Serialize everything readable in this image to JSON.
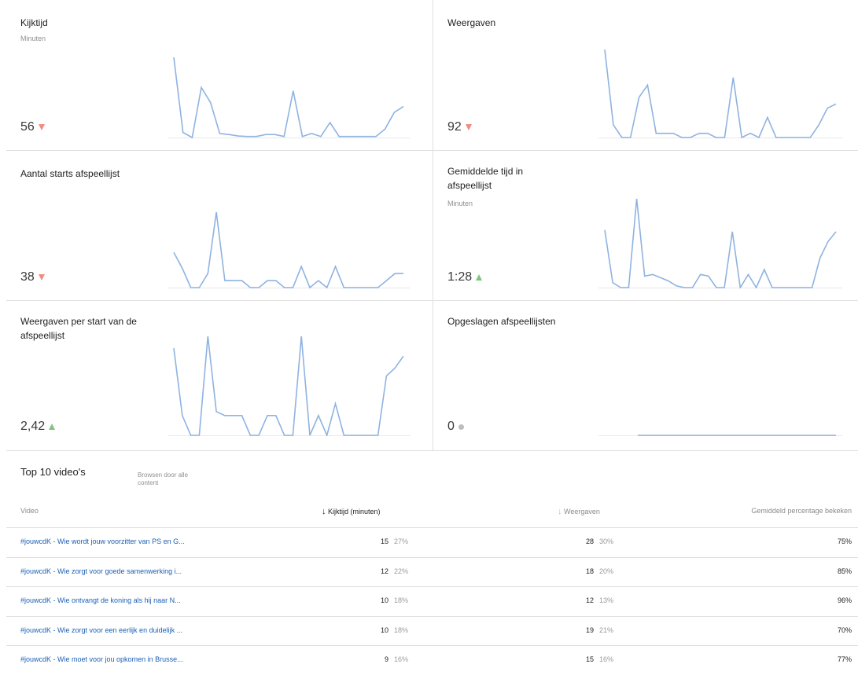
{
  "cards": [
    {
      "title": "Kijktijd",
      "unit": "Minuten",
      "value": "56",
      "trend": "down",
      "spark": [
        16,
        1,
        0,
        10,
        7,
        0.8,
        0.6,
        0.3,
        0.2,
        0.2,
        0.6,
        0.6,
        0.2,
        9.3,
        0.2,
        0.8,
        0.2,
        3,
        0.2,
        0.2,
        0.2,
        0.2,
        0.2,
        1.7,
        5,
        6.2
      ]
    },
    {
      "title": "Weergaven",
      "unit": "",
      "value": "92",
      "trend": "down",
      "spark": [
        21,
        3,
        0,
        0,
        9.6,
        12.5,
        1,
        1,
        1,
        0,
        0,
        1,
        1,
        0,
        0,
        14.3,
        0,
        1,
        0,
        4.8,
        0,
        0,
        0,
        0,
        0,
        3,
        7,
        8
      ]
    },
    {
      "title": "Aantal starts afspeellijst",
      "unit": "",
      "value": "38",
      "trend": "down",
      "spark": [
        4,
        2.2,
        0,
        0,
        1.6,
        8.6,
        0.8,
        0.8,
        0.8,
        0,
        0,
        0.8,
        0.8,
        0,
        0,
        2.4,
        0,
        0.8,
        0,
        2.4,
        0,
        0,
        0,
        0,
        0,
        0.8,
        1.6,
        1.6
      ]
    },
    {
      "title": "Gemiddelde tijd in afspeellijst",
      "unit": "Minuten",
      "value": "1:28",
      "trend": "up",
      "spark": [
        3.5,
        0.3,
        0,
        0,
        5.4,
        0.7,
        0.8,
        0.6,
        0.4,
        0.1,
        0,
        0,
        0.8,
        0.7,
        0,
        0,
        3.4,
        0,
        0.8,
        0,
        1.1,
        0,
        0,
        0,
        0,
        0,
        0,
        1.8,
        2.8,
        3.4
      ]
    },
    {
      "title": "Weergaven per start van de afspeellijst",
      "unit": "",
      "value": "2,42",
      "trend": "up",
      "spark": [
        4.4,
        1,
        0,
        0,
        5,
        1.2,
        1,
        1,
        1,
        0,
        0,
        1,
        1,
        0,
        0,
        5,
        0,
        1,
        0,
        1.6,
        0,
        0,
        0,
        0,
        0,
        3,
        3.4,
        4
      ]
    },
    {
      "title": "Opgeslagen afspeellijsten",
      "unit": "",
      "value": "0",
      "trend": "flat",
      "spark": [
        0,
        0
      ]
    }
  ],
  "top": {
    "title": "Top 10 video's",
    "browse": "Browsen door alle content",
    "headers": {
      "video": "Video",
      "watch": "Kijktijd (minuten)",
      "views": "Weergaven",
      "avg": "Gemiddeld percentage bekeken"
    },
    "rows": [
      {
        "title": "#jouwcdK - Wie wordt jouw voorzitter van PS en G...",
        "watch": "15",
        "watch_pct": "27%",
        "views": "28",
        "views_pct": "30%",
        "avg": "75%"
      },
      {
        "title": "#jouwcdK - Wie zorgt voor goede samenwerking i...",
        "watch": "12",
        "watch_pct": "22%",
        "views": "18",
        "views_pct": "20%",
        "avg": "85%"
      },
      {
        "title": "#jouwcdK - Wie ontvangt de koning als hij naar N...",
        "watch": "10",
        "watch_pct": "18%",
        "views": "12",
        "views_pct": "13%",
        "avg": "96%"
      },
      {
        "title": "#jouwcdK - Wie zorgt voor een eerlijk en duidelijk ...",
        "watch": "10",
        "watch_pct": "18%",
        "views": "19",
        "views_pct": "21%",
        "avg": "70%"
      },
      {
        "title": "#jouwcdK - Wie moet voor jou opkomen in Brusse...",
        "watch": "9",
        "watch_pct": "16%",
        "views": "15",
        "views_pct": "16%",
        "avg": "77%"
      }
    ]
  }
}
